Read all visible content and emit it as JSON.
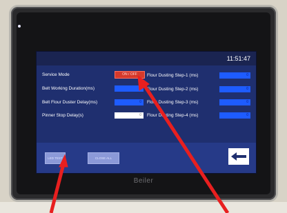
{
  "device": {
    "brand": "Beiler"
  },
  "screen": {
    "clock": "11:51:47",
    "left_fields": [
      {
        "label": "Service Mode"
      },
      {
        "label": "Belt Working Duration(ms)",
        "value": "0"
      },
      {
        "label": "Belt Flour Duster Delay(ms)",
        "value": "0"
      },
      {
        "label": "Pinner Stop Delay(s)",
        "value": "0"
      }
    ],
    "service_toggle": "ON / OFF",
    "right_fields": [
      {
        "label": "Flour Dusting Step-1 (ms)",
        "value": "0"
      },
      {
        "label": "Flour Dusting Step-2 (ms)",
        "value": "0"
      },
      {
        "label": "Flour Dusting Step-3 (ms)",
        "value": "0"
      },
      {
        "label": "Flour Dusting Step-4 (ms)",
        "value": "0"
      }
    ],
    "buttons": {
      "led_test": "LED TEST",
      "close_all": "CLOSE ALL"
    }
  },
  "colors": {
    "annotation_arrow": "#e81f1f",
    "hmi_bg": "#1f2f6f",
    "toggle_on": "#d63a2b"
  }
}
